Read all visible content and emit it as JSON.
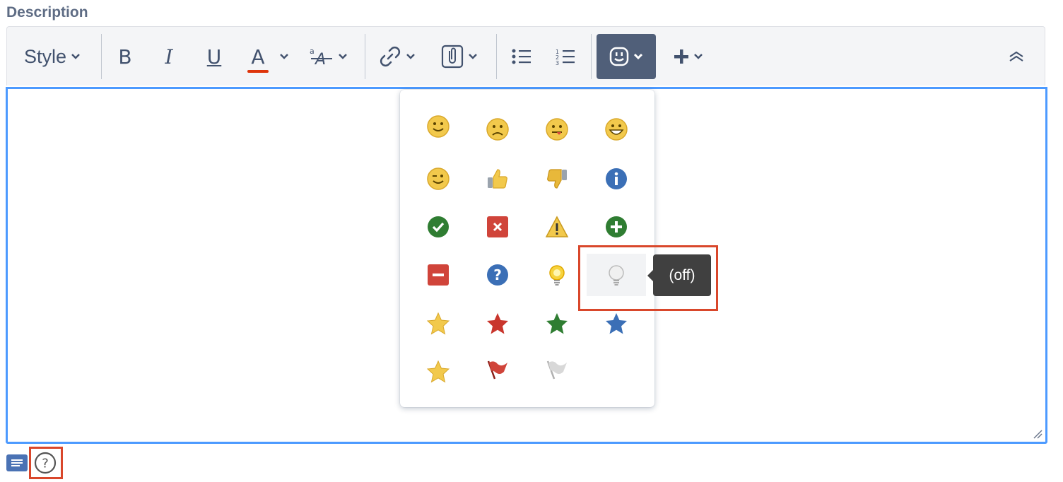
{
  "field": {
    "label": "Description"
  },
  "toolbar": {
    "style_label": "Style",
    "bold": "B",
    "italic": "I",
    "underline": "U",
    "text_color": "A",
    "accent_color": "#de350b",
    "active_bg": "#505f79"
  },
  "emoticons": {
    "rows": [
      [
        "smile",
        "sad",
        "cheeky",
        "laugh"
      ],
      [
        "wink",
        "thumbs-up",
        "thumbs-down",
        "information"
      ],
      [
        "tick",
        "cross",
        "warning",
        "plus"
      ],
      [
        "minus",
        "question",
        "light-on",
        "light-off"
      ],
      [
        "yellow-star",
        "red-star",
        "green-star",
        "blue-star"
      ],
      [
        "yellow-star",
        "flag",
        "flag-off"
      ]
    ],
    "hovered": "light-off",
    "tooltip": "(off)"
  },
  "colors": {
    "highlight": "#d9472b",
    "focus": "#4c9aff"
  }
}
